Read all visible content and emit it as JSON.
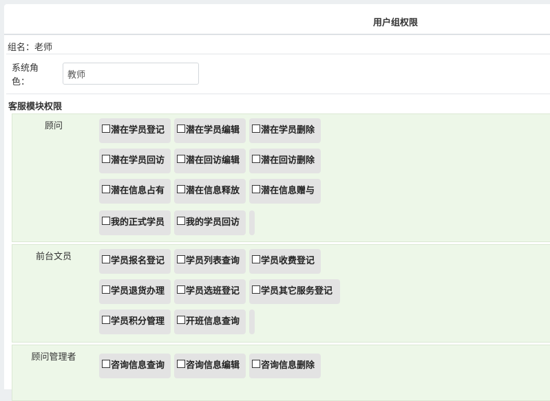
{
  "header": {
    "title": "用户组权限"
  },
  "group": {
    "label": "组名：",
    "value": "老师"
  },
  "role": {
    "label": "系统角色：",
    "value": "教师"
  },
  "section": {
    "title": "客服模块权限"
  },
  "modules": [
    {
      "name": "顾问",
      "rows": [
        [
          "潜在学员登记",
          "潜在学员编辑",
          "潜在学员删除"
        ],
        [
          "潜在学员回访",
          "潜在回访编辑",
          "潜在回访删除"
        ],
        [
          "潜在信息占有",
          "潜在信息释放",
          "潜在信息赠与"
        ],
        [
          "我的正式学员",
          "我的学员回访"
        ]
      ]
    },
    {
      "name": "前台文员",
      "rows": [
        [
          "学员报名登记",
          "学员列表查询",
          "学员收费登记"
        ],
        [
          "学员退货办理",
          "学员选班登记",
          "学员其它服务登记"
        ],
        [
          "学员积分管理",
          "开班信息查询"
        ]
      ]
    },
    {
      "name": "顾问管理者",
      "rows": [
        [
          "咨询信息查询",
          "咨询信息编辑",
          "咨询信息删除"
        ]
      ]
    }
  ]
}
